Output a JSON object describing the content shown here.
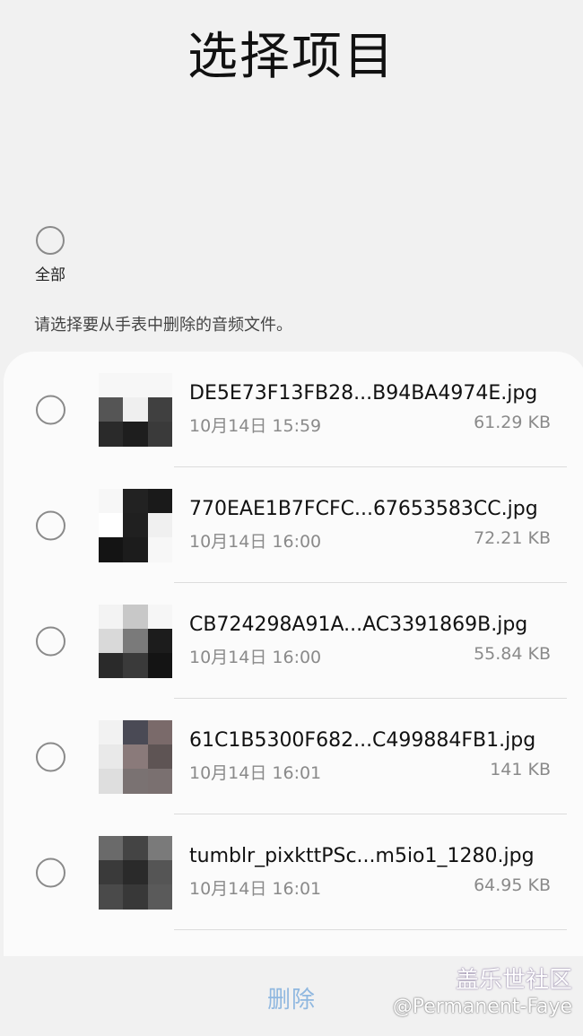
{
  "header": {
    "title": "选择项目"
  },
  "select_all": {
    "label": "全部"
  },
  "instruction": "请选择要从手表中删除的音频文件。",
  "files": [
    {
      "name": "DE5E73F13FB28...B94BA4974E.jpg",
      "date": "10月14日 15:59",
      "size": "61.29 KB",
      "thumb": [
        "#f7f7f7",
        "#f7f7f7",
        "#f7f7f7",
        "#555555",
        "#efefef",
        "#404040",
        "#2a2a2a",
        "#1e1e1e",
        "#3a3a3a"
      ]
    },
    {
      "name": "770EAE1B7FCFC...67653583CC.jpg",
      "date": "10月14日 16:00",
      "size": "72.21 KB",
      "thumb": [
        "#f7f7f7",
        "#222222",
        "#1a1a1a",
        "#ffffff",
        "#202020",
        "#f0f0f0",
        "#141414",
        "#1c1c1c",
        "#f7f7f7"
      ]
    },
    {
      "name": "CB724298A91A...AC3391869B.jpg",
      "date": "10月14日 16:00",
      "size": "55.84 KB",
      "thumb": [
        "#f3f3f3",
        "#c8c8c8",
        "#f6f6f6",
        "#d9d9d9",
        "#7a7a7a",
        "#1c1c1c",
        "#2a2a2a",
        "#3a3a3a",
        "#141414"
      ]
    },
    {
      "name": "61C1B5300F682...C499884FB1.jpg",
      "date": "10月14日 16:01",
      "size": "141 KB",
      "thumb": [
        "#f2f2f2",
        "#4a4a55",
        "#7a6a6a",
        "#e9e9e9",
        "#8a7a7a",
        "#5e5454",
        "#dedede",
        "#7a7272",
        "#7a7070"
      ]
    },
    {
      "name": "tumblr_pixkttPSc...m5io1_1280.jpg",
      "date": "10月14日 16:01",
      "size": "64.95 KB",
      "thumb": [
        "#6a6a6a",
        "#444444",
        "#7a7a7a",
        "#3a3a3a",
        "#2a2a2a",
        "#555555",
        "#4a4a4a",
        "#383838",
        "#5a5a5a"
      ]
    }
  ],
  "footer": {
    "delete_label": "删除"
  },
  "watermark": {
    "brand": "盖乐世社区",
    "user": "@Permanent-Faye"
  }
}
